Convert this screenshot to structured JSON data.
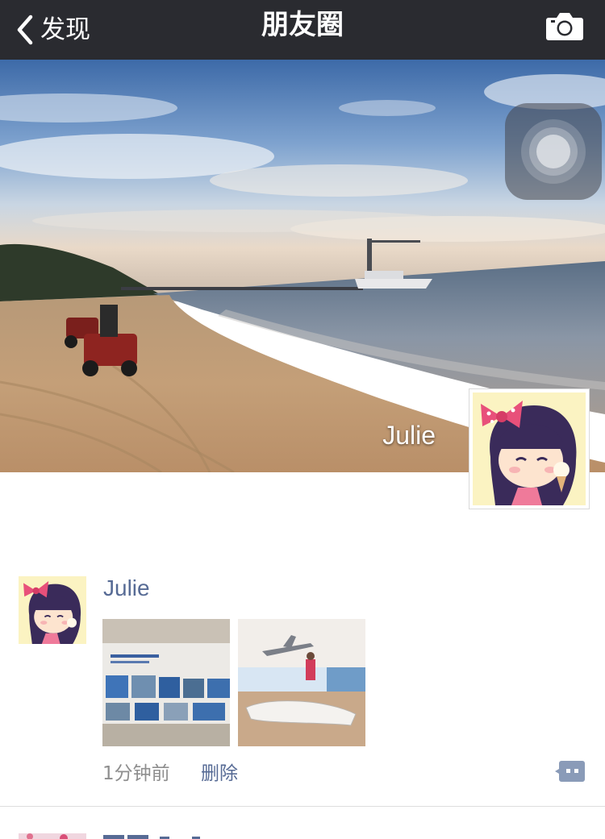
{
  "nav": {
    "back_label": "发现",
    "title": "朋友圈",
    "camera_icon": "camera-icon",
    "back_icon": "chevron-left-icon",
    "background": "#2a2b30"
  },
  "cover": {
    "name": "Julie"
  },
  "posts": [
    {
      "name": "Julie",
      "time": "1分钟前",
      "delete_label": "删除",
      "more_icon": "comment-dots-icon"
    }
  ],
  "colors": {
    "link": "#576b95",
    "meta": "#8e8e8e"
  }
}
